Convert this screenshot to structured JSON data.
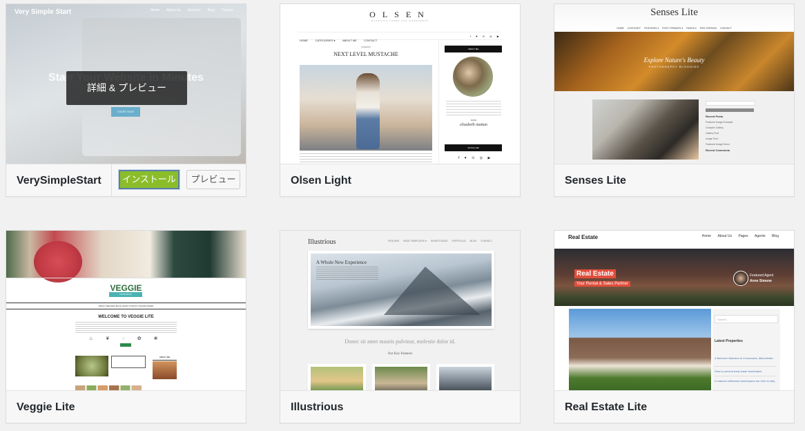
{
  "themes": [
    {
      "name": "VerySimpleStart",
      "screenshot": {
        "site_title": "Very Simple Start",
        "nav": [
          "Home",
          "About Us",
          "Services",
          "Blog",
          "Contact"
        ],
        "hero_text": "Start Your Website in Minutes",
        "button": "START NOW"
      },
      "overlay_label": "詳細 & プレビュー",
      "install_label": "インストール",
      "preview_label": "プレビュー"
    },
    {
      "name": "Olsen Light",
      "screenshot": {
        "logo": "OLSEN",
        "tagline": "BLOGGING THEME FOR WORDPRESS",
        "menu": [
          "HOME",
          "CATEGORIES ▾",
          "ABOUT ME",
          "CONTACT"
        ],
        "category": "FASHION",
        "post_title": "NEXT LEVEL MUSTACHE",
        "about_me": "ABOUT ME",
        "xoxo": "XOXO",
        "signature": "elizabeth mattan",
        "social_me": "SOCIAL ME",
        "social_icons": "f ♥ ⊙ ◎ ▶"
      }
    },
    {
      "name": "Senses Lite",
      "screenshot": {
        "logo": "Senses Lite",
        "menu": [
          "HOME",
          "CATEGORY",
          "FEATURES ▾",
          "POST FORMATS ▾",
          "PAGES ▾",
          "PRO VERSION",
          "CONTACT"
        ],
        "banner_title": "Explore Nature's Beauty",
        "banner_sub": "PHOTOGRAPHY BLOGGING",
        "recent_posts": "Recent Posts",
        "recent_comments": "Recent Comments",
        "search": "SEARCH",
        "posts": [
          "Featured Image Example",
          "Complex Gallery",
          "Gallery Post",
          "Image Post",
          "Featured Image Demo"
        ]
      }
    },
    {
      "name": "Veggie Lite",
      "screenshot": {
        "logo": "VEGGIE",
        "logo_sub": "FOOD BLOG",
        "menu": "ABOUT   RECIPES   BLOG   SHOP   CONTACT   SHORTCODES",
        "welcome": "WELCOME TO VEGGIE LITE",
        "icons": "♨ ❦ ◌ ✿ ❀",
        "about_me": "ABOUT ME"
      }
    },
    {
      "name": "Illustrious",
      "screenshot": {
        "logo": "Illustrious",
        "menu": [
          "FEATURE",
          "PAGE TEMPLATES ▾",
          "SHORTCODES",
          "PORTFOLIO",
          "BLOG",
          "CONTACT"
        ],
        "slide_title": "A Whole New Experience",
        "tagline": "Donec sit amet mauris pulvinar, molestie dolor id.",
        "features": "Our Key Features"
      }
    },
    {
      "name": "Real Estate Lite",
      "screenshot": {
        "logo": "Real Estate",
        "menu": [
          "Home",
          "About Us",
          "Pages",
          "Agents",
          "Blog"
        ],
        "hero_title": "Real Estate",
        "hero_sub": "Your Rental & Sales Partner",
        "agent_label": "Featured Agent",
        "agent_name": "Anne Simone",
        "search": "Search...",
        "latest": "Latest Properties",
        "properties": [
          "4 Bedroom Mansion in Crossroads, Manchester.",
          "How to prevent early lease termination.",
          "4 reasons millennial homebuyers are here to stay"
        ]
      }
    }
  ]
}
